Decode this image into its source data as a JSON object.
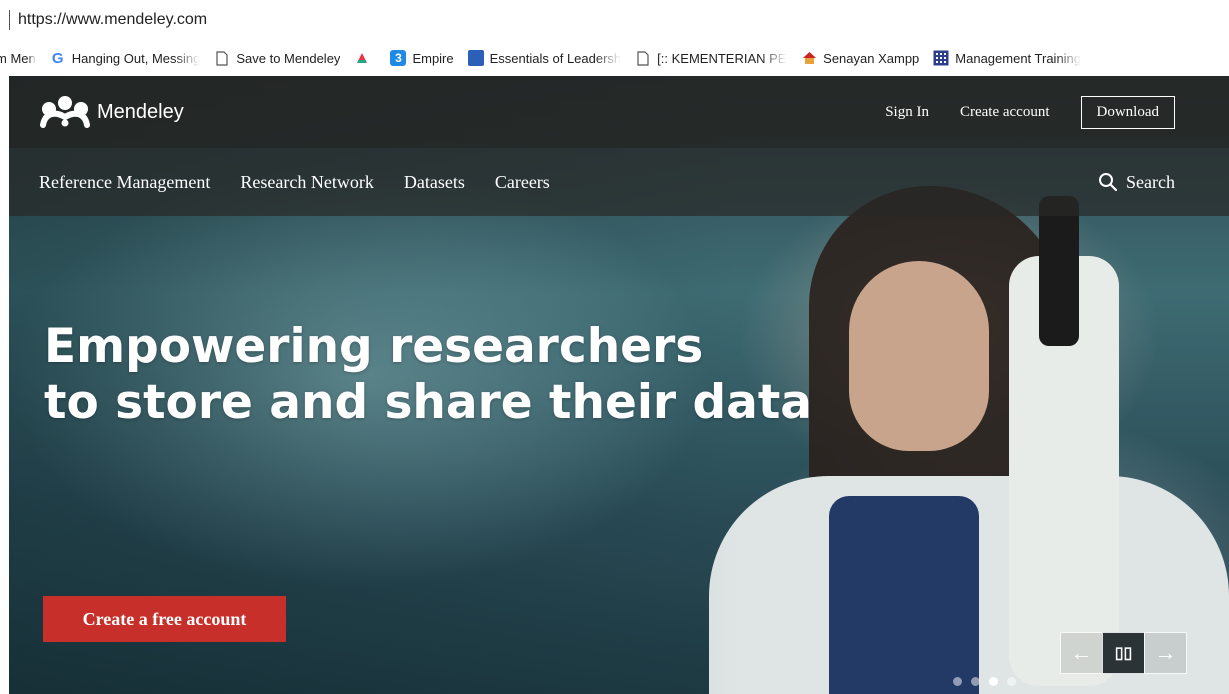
{
  "browser": {
    "url": "https://www.mendeley.com"
  },
  "bookmarks": [
    {
      "label": "m Men",
      "icon": "partial-bookmark-icon"
    },
    {
      "label": "Hanging Out, Messing",
      "icon": "google-icon"
    },
    {
      "label": "Save to Mendeley",
      "icon": "page-icon"
    },
    {
      "label": "",
      "icon": "colorful-bookmark-icon"
    },
    {
      "label": "Empire",
      "icon": "three-icon"
    },
    {
      "label": "Essentials of Leadersh",
      "icon": "book-icon"
    },
    {
      "label": "[:: KEMENTERIAN PEN",
      "icon": "page-icon"
    },
    {
      "label": "Senayan Xampp",
      "icon": "house-icon"
    },
    {
      "label": "Management Training",
      "icon": "grid-icon"
    }
  ],
  "header": {
    "logo_text": "Mendeley",
    "sign_in": "Sign In",
    "create_account": "Create account",
    "download": "Download"
  },
  "nav": {
    "items": [
      "Reference Management",
      "Research Network",
      "Datasets",
      "Careers"
    ],
    "search": "Search"
  },
  "hero": {
    "line1": "Empowering researchers",
    "line2": "to store and share their data",
    "cta": "Create a free account",
    "slide_count": 4,
    "active_slide": 3
  },
  "carousel": {
    "prev": "←",
    "pause": "▯▯",
    "next": "→"
  },
  "colors": {
    "cta": "#c62f2a",
    "header_bg": "#232321"
  }
}
